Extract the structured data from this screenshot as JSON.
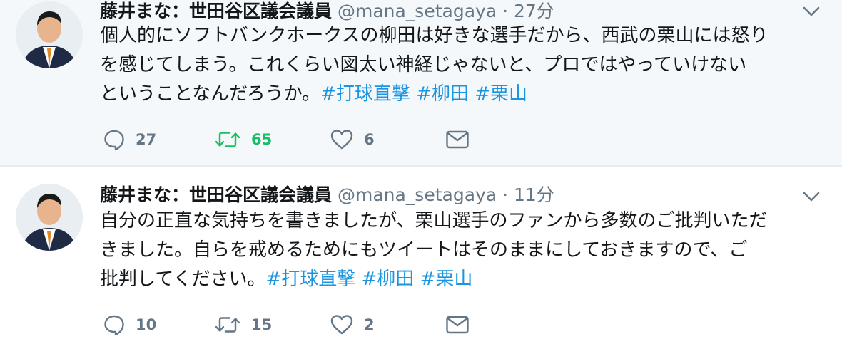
{
  "tweets": [
    {
      "author_name": "藤井まな：世田谷区議会議員",
      "handle": "@mana_setagaya",
      "separator": "·",
      "time": "27分",
      "text_lines": [
        "個人的にソフトバンクホークスの柳田は好きな選手だから、西武の栗山には怒り",
        "を感じてしまう。これくらい図太い神経じゃないと、プロではやっていけない"
      ],
      "last_line_text": "ということなんだろうか。",
      "hashtags": [
        "#打球直撃",
        "#柳田",
        "#栗山"
      ],
      "actions": {
        "reply_count": "27",
        "retweet_count": "65",
        "like_count": "6"
      },
      "retweeted": true
    },
    {
      "author_name": "藤井まな：世田谷区議会議員",
      "handle": "@mana_setagaya",
      "separator": "·",
      "time": "11分",
      "text_lines": [
        "自分の正直な気持ちを書きましたが、栗山選手のファンから多数のご批判いただ",
        "きました。自らを戒めるためにもツイートはそのままにしておきますので、ご"
      ],
      "last_line_text": "批判してください。",
      "hashtags": [
        "#打球直撃",
        "#柳田",
        "#栗山"
      ],
      "actions": {
        "reply_count": "10",
        "retweet_count": "15",
        "like_count": "2"
      },
      "retweeted": false
    }
  ],
  "colors": {
    "hashtag": "#1b95e0",
    "retweet_active": "#17bf63",
    "icon_gray": "#657786",
    "top_background": "#f5f8fa"
  },
  "icons": [
    "avatar",
    "chevron-down-icon",
    "reply-icon",
    "retweet-icon",
    "like-icon",
    "dm-icon"
  ]
}
